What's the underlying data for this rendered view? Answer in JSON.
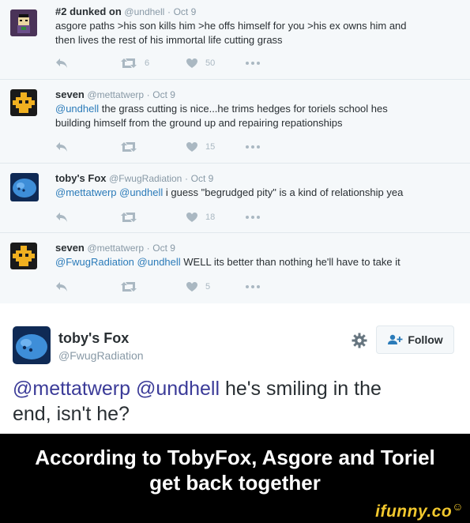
{
  "tweets": [
    {
      "name": "#2 dunked on",
      "handle": "@undhell",
      "sep": "·",
      "date": "Oct 9",
      "text_line1": "asgore paths >his son kills him >he offs himself for you  >his ex owns him and",
      "text_line2": "then lives the rest of his immortal life cutting grass",
      "retweets": "6",
      "likes": "50"
    },
    {
      "name": "seven",
      "handle": "@mettatwerp",
      "sep": "·",
      "date": "Oct 9",
      "mention1": "@undhell",
      "text_line1": " the grass cutting is nice...he trims hedges for toriels school hes",
      "text_line2": "building himself from the ground up and repairing repationships",
      "retweets": "",
      "likes": "15"
    },
    {
      "name": "toby's Fox",
      "handle": "@FwugRadiation",
      "sep": "·",
      "date": "Oct 9",
      "mention1": "@mettatwerp",
      "mention2": "@undhell",
      "text_line1": " i guess \"begrudged pity\" is a kind of relationship yea",
      "retweets": "",
      "likes": "18"
    },
    {
      "name": "seven",
      "handle": "@mettatwerp",
      "sep": "·",
      "date": "Oct 9",
      "mention1": "@FwugRadiation",
      "mention2": "@undhell",
      "text_line1": " WELL its better than nothing he'll have to take it",
      "retweets": "",
      "likes": "5"
    }
  ],
  "featured": {
    "name": "toby's Fox",
    "handle": "@FwugRadiation",
    "follow_label": "Follow",
    "mention1": "@mettatwerp",
    "mention2": "@undhell",
    "text1": " he's smiling in the",
    "text2": "end, isn't he?"
  },
  "caption": {
    "line1": "According to TobyFox, Asgore and Toriel",
    "line2": "get back together"
  },
  "watermark": {
    "text": "ifunny.co",
    "icon": "smiley-icon"
  },
  "colors": {
    "link": "#2b7bb9",
    "featured_link": "#3b3b98",
    "muted": "#8899a6",
    "watermark": "#f2c82e"
  },
  "icons": [
    "reply-icon",
    "retweet-icon",
    "heart-icon",
    "more-icon",
    "gear-icon",
    "add-user-icon"
  ]
}
